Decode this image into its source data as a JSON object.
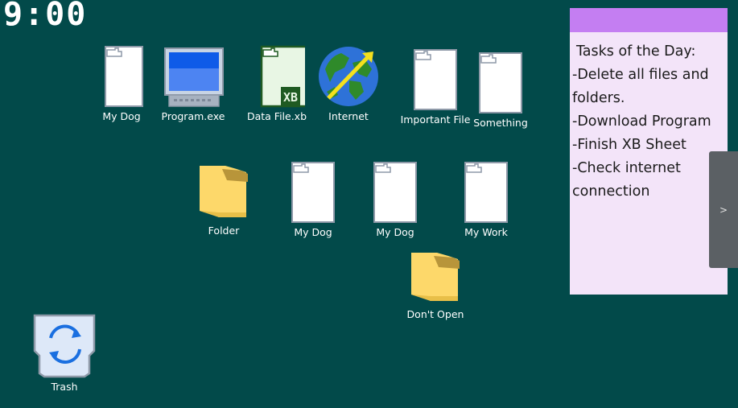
{
  "clock": "9:00",
  "desktop": {
    "icons": {
      "my_dog_1": "My Dog",
      "program": "Program.exe",
      "data_file": "Data File.xb",
      "internet": "Internet",
      "important": "Important File",
      "something": "Something",
      "folder": "Folder",
      "my_dog_2": "My Dog",
      "my_dog_3": "My Dog",
      "my_work": "My Work",
      "dont_open": "Don't Open",
      "trash": "Trash"
    },
    "data_file_badge": "XB"
  },
  "tasks_panel": {
    "title": "Tasks of the Day:",
    "tasks": [
      "-Delete all files and folders.",
      "-Download Program",
      "-Finish XB Sheet",
      "-Check internet connection"
    ],
    "header_color": "#c47ef2",
    "background_color": "#f3e4f9"
  },
  "side_tab": {
    "label": ">"
  },
  "colors": {
    "desktop_bg": "#024a4a",
    "folder": "#fdd86a",
    "trash_bg": "#dde8f8",
    "recycle_arrows": "#1a6fe0"
  }
}
